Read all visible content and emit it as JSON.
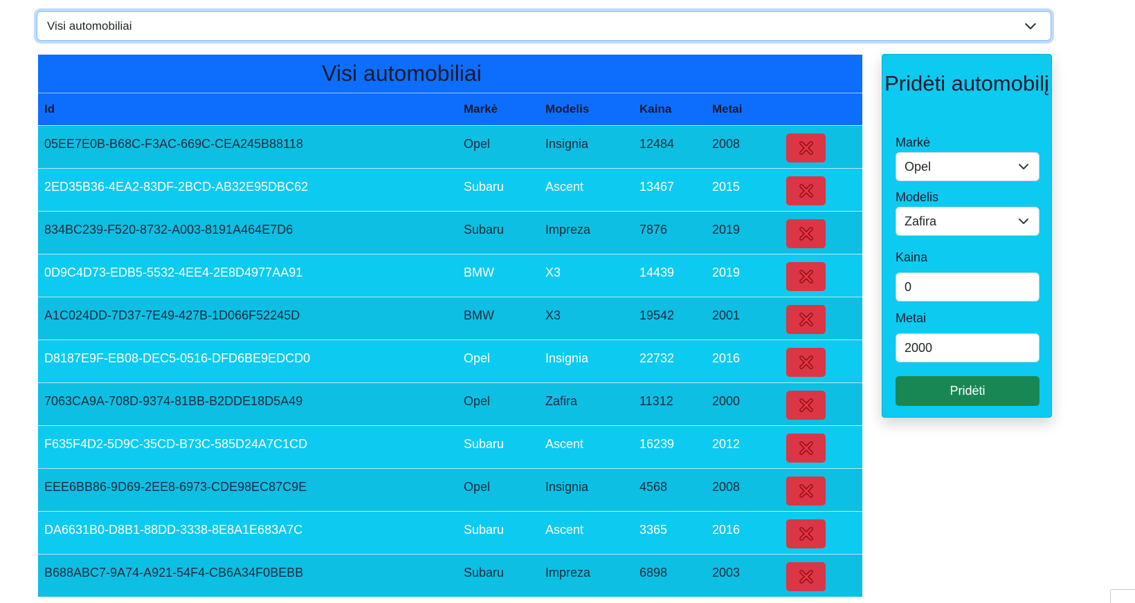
{
  "filter": {
    "selected": "Visi automobiliai"
  },
  "table": {
    "title": "Visi automobiliai",
    "headers": {
      "id": "Id",
      "make": "Markė",
      "model": "Modelis",
      "price": "Kaina",
      "year": "Metai"
    },
    "rows": [
      {
        "id": "05EE7E0B-B68C-F3AC-669C-CEA245B88118",
        "make": "Opel",
        "model": "Insignia",
        "price": "12484",
        "year": "2008"
      },
      {
        "id": "2ED35B36-4EA2-83DF-2BCD-AB32E95DBC62",
        "make": "Subaru",
        "model": "Ascent",
        "price": "13467",
        "year": "2015"
      },
      {
        "id": "834BC239-F520-8732-A003-8191A464E7D6",
        "make": "Subaru",
        "model": "Impreza",
        "price": "7876",
        "year": "2019"
      },
      {
        "id": "0D9C4D73-EDB5-5532-4EE4-2E8D4977AA91",
        "make": "BMW",
        "model": "X3",
        "price": "14439",
        "year": "2019"
      },
      {
        "id": "A1C024DD-7D37-7E49-427B-1D066F52245D",
        "make": "BMW",
        "model": "X3",
        "price": "19542",
        "year": "2001"
      },
      {
        "id": "D8187E9F-EB08-DEC5-0516-DFD6BE9EDCD0",
        "make": "Opel",
        "model": "Insignia",
        "price": "22732",
        "year": "2016"
      },
      {
        "id": "7063CA9A-708D-9374-81BB-B2DDE18D5A49",
        "make": "Opel",
        "model": "Zafira",
        "price": "11312",
        "year": "2000"
      },
      {
        "id": "F635F4D2-5D9C-35CD-B73C-585D24A7C1CD",
        "make": "Subaru",
        "model": "Ascent",
        "price": "16239",
        "year": "2012"
      },
      {
        "id": "EEE6BB86-9D69-2EE8-6973-CDE98EC87C9E",
        "make": "Opel",
        "model": "Insignia",
        "price": "4568",
        "year": "2008"
      },
      {
        "id": "DA6631B0-D8B1-88DD-3338-8E8A1E683A7C",
        "make": "Subaru",
        "model": "Ascent",
        "price": "3365",
        "year": "2016"
      },
      {
        "id": "B688ABC7-9A74-A921-54F4-CB6A34F0BEBB",
        "make": "Subaru",
        "model": "Impreza",
        "price": "6898",
        "year": "2003"
      }
    ]
  },
  "add_form": {
    "title": "Pridėti automobilį",
    "make_label": "Markė",
    "make_value": "Opel",
    "model_label": "Modelis",
    "model_value": "Zafira",
    "price_label": "Kaina",
    "price_value": "0",
    "year_label": "Metai",
    "year_value": "2000",
    "submit_label": "Pridėti"
  },
  "colors": {
    "header_blue": "#0d6efd",
    "row_cyan": "#0dcaf0",
    "delete_red": "#dc3545",
    "submit_green": "#198754"
  }
}
